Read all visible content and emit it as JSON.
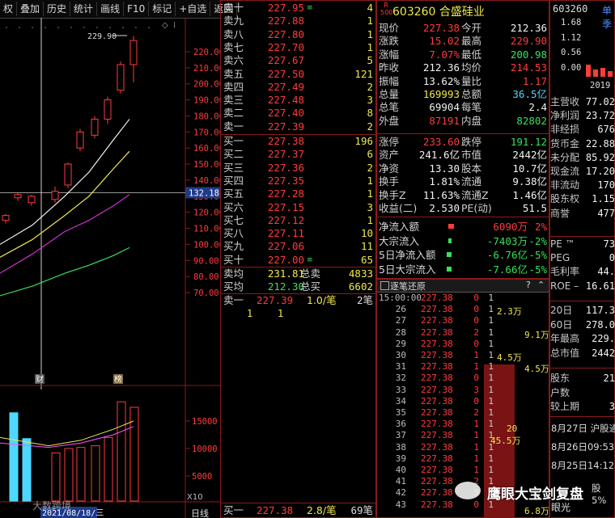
{
  "toolbar": {
    "items": [
      "权",
      "叠加",
      "历史",
      "统计",
      "画线",
      "F10",
      "标记",
      "+自选",
      "返回"
    ]
  },
  "kchart": {
    "high_label": "229.90",
    "price_ticks": [
      "220.00",
      "210.00",
      "200.00",
      "190.00",
      "180.00",
      "170.00",
      "160.00",
      "150.00",
      "140.00",
      "130.00",
      "120.00",
      "110.00",
      "100.00",
      "90.00",
      "80.00",
      "70.00"
    ],
    "current_tag": "132.18",
    "marker_cai": "财",
    "marker_bang": "榜",
    "vol_ticks": [
      "15000",
      "10000",
      "5000"
    ],
    "vol_unit": "X10",
    "date_label": "2021/08/18/三",
    "period_label": "日线",
    "watermark": "大数跨境"
  },
  "orderbook": {
    "sells": [
      {
        "label": "卖十",
        "price": "227.95",
        "vol": "4",
        "flag": "≡"
      },
      {
        "label": "卖九",
        "price": "227.88",
        "vol": "1"
      },
      {
        "label": "卖八",
        "price": "227.80",
        "vol": "1"
      },
      {
        "label": "卖七",
        "price": "227.70",
        "vol": "1"
      },
      {
        "label": "卖六",
        "price": "227.67",
        "vol": "5"
      },
      {
        "label": "卖五",
        "price": "227.50",
        "vol": "121"
      },
      {
        "label": "卖四",
        "price": "227.49",
        "vol": "2"
      },
      {
        "label": "卖三",
        "price": "227.48",
        "vol": "3"
      },
      {
        "label": "卖二",
        "price": "227.40",
        "vol": "8"
      },
      {
        "label": "卖一",
        "price": "227.39",
        "vol": "2"
      }
    ],
    "buys": [
      {
        "label": "买一",
        "price": "227.38",
        "vol": "196"
      },
      {
        "label": "买二",
        "price": "227.37",
        "vol": "6"
      },
      {
        "label": "买三",
        "price": "227.36",
        "vol": "2"
      },
      {
        "label": "买四",
        "price": "227.35",
        "vol": "1"
      },
      {
        "label": "买五",
        "price": "227.28",
        "vol": "1"
      },
      {
        "label": "买六",
        "price": "227.15",
        "vol": "3"
      },
      {
        "label": "买七",
        "price": "227.12",
        "vol": "1"
      },
      {
        "label": "买八",
        "price": "227.11",
        "vol": "10"
      },
      {
        "label": "买九",
        "price": "227.06",
        "vol": "11"
      },
      {
        "label": "买十",
        "price": "227.00",
        "vol": "65",
        "flag": "≡"
      }
    ],
    "avg_sell_label": "卖均",
    "avg_sell": "231.81",
    "total_sell_label": "总卖",
    "total_sell": "4833",
    "avg_buy_label": "买均",
    "avg_buy": "212.30",
    "total_buy_label": "总买",
    "total_buy": "6602",
    "queue_sell_label": "卖一",
    "queue_sell_price": "227.39",
    "queue_sell_ratio": "1.0/笔",
    "queue_sell_count": "2笔",
    "queue_sell_items": [
      "1",
      "1"
    ],
    "queue_buy_label": "买一",
    "queue_buy_price": "227.38",
    "queue_buy_ratio": "2.8/笔",
    "queue_buy_count": "69笔"
  },
  "stock": {
    "code": "603260",
    "name": "合盛硅业",
    "badge_top": "R",
    "badge_bottom": "500"
  },
  "quote": [
    {
      "l1": "现价",
      "v1": "227.38",
      "c1": "red",
      "l2": "今开",
      "v2": "212.36",
      "c2": "white"
    },
    {
      "l1": "涨跌",
      "v1": "15.02",
      "c1": "red",
      "l2": "最高",
      "v2": "229.90",
      "c2": "red"
    },
    {
      "l1": "涨幅",
      "v1": "7.07%",
      "c1": "red",
      "l2": "最低",
      "v2": "200.98",
      "c2": "green"
    },
    {
      "l1": "昨收",
      "v1": "212.36",
      "c1": "white",
      "l2": "均价",
      "v2": "214.53",
      "c2": "red"
    },
    {
      "l1": "振幅",
      "v1": "13.62%",
      "c1": "white",
      "l2": "量比",
      "v2": "1.17",
      "c2": "red"
    },
    {
      "l1": "总量",
      "v1": "169993",
      "c1": "yellow",
      "l2": "总额",
      "v2": "36.5亿",
      "c2": "cyan"
    },
    {
      "l1": "总笔",
      "v1": "69904",
      "c1": "white",
      "l2": "每笔",
      "v2": "2.4",
      "c2": "white"
    },
    {
      "l1": "外盘",
      "v1": "87191",
      "c1": "red",
      "l2": "内盘",
      "v2": "82802",
      "c2": "green"
    }
  ],
  "quote2": [
    {
      "l1": "涨停",
      "v1": "233.60",
      "c1": "red",
      "l2": "跌停",
      "v2": "191.12",
      "c2": "green"
    },
    {
      "l1": "资产",
      "v1": "241.6亿",
      "c1": "white",
      "l2": "市值",
      "v2": "2442亿",
      "c2": "white"
    },
    {
      "l1": "净资",
      "v1": "13.30",
      "c1": "white",
      "l2": "股本",
      "v2": "10.7亿",
      "c2": "white"
    },
    {
      "l1": "换手",
      "v1": "1.81%",
      "c1": "white",
      "l2": "流通",
      "v2": "9.38亿",
      "c2": "white"
    },
    {
      "l1": "换手Z",
      "v1": "11.63%",
      "c1": "white",
      "l2": "流通Z",
      "v2": "1.46亿",
      "c2": "white"
    },
    {
      "l1": "收益(二)",
      "v1": "2.530",
      "c1": "white",
      "l2": "PE(动)",
      "v2": "51.5",
      "c2": "white"
    }
  ],
  "flows": [
    {
      "label": "净流入额",
      "value": "6090万",
      "pct": "2%",
      "color": "red",
      "bar_pct": 0.6
    },
    {
      "label": "大宗流入",
      "value": "-7403万",
      "pct": "-2%",
      "color": "green",
      "bar_pct": 0.2
    },
    {
      "label": "5日净流入额",
      "value": "-6.76亿",
      "pct": "-5%",
      "color": "green",
      "bar_pct": 0.5
    },
    {
      "label": "5日大宗流入",
      "value": "-7.66亿",
      "pct": "-5%",
      "color": "green",
      "bar_pct": 0.5
    }
  ],
  "ticks_panel": {
    "title": "逐笔还原",
    "help": "?",
    "close": "⌃",
    "rows": [
      {
        "t": "15:00:00",
        "p": "227.38",
        "v": "0",
        "n": "1"
      },
      {
        "t": "26",
        "p": "227.38",
        "v": "0",
        "n": "1"
      },
      {
        "t": "27",
        "p": "227.38",
        "v": "0",
        "n": "1"
      },
      {
        "t": "28",
        "p": "227.38",
        "v": "2",
        "n": "1"
      },
      {
        "t": "29",
        "p": "227.38",
        "v": "0",
        "n": "1"
      },
      {
        "t": "30",
        "p": "227.38",
        "v": "1",
        "n": "1"
      },
      {
        "t": "31",
        "p": "227.38",
        "v": "1",
        "n": "1"
      },
      {
        "t": "32",
        "p": "227.38",
        "v": "0",
        "n": "1"
      },
      {
        "t": "33",
        "p": "227.38",
        "v": "3",
        "n": "1"
      },
      {
        "t": "34",
        "p": "227.38",
        "v": "0",
        "n": "1"
      },
      {
        "t": "35",
        "p": "227.38",
        "v": "2",
        "n": "1"
      },
      {
        "t": "36",
        "p": "227.38",
        "v": "1",
        "n": "1"
      },
      {
        "t": "37",
        "p": "227.38",
        "v": "1",
        "n": "1"
      },
      {
        "t": "38",
        "p": "227.38",
        "v": "1",
        "n": "1"
      },
      {
        "t": "39",
        "p": "227.38",
        "v": "1",
        "n": "1"
      },
      {
        "t": "40",
        "p": "227.38",
        "v": "1",
        "n": "1"
      },
      {
        "t": "41",
        "p": "227.38",
        "v": "2",
        "n": "1"
      },
      {
        "t": "42",
        "p": "227.38",
        "v": "5",
        "n": "1"
      },
      {
        "t": "43",
        "p": "227.38",
        "v": "0",
        "n": "1"
      }
    ],
    "side_labels": [
      {
        "text": "2.3万"
      },
      {
        "text": "9.1万"
      },
      {
        "text": "4.5万"
      },
      {
        "text": "4.5万"
      },
      {
        "text": "20"
      },
      {
        "text": "45.5万"
      },
      {
        "text": "6.8万"
      }
    ]
  },
  "right_panel": {
    "code": "603260",
    "tab": "单季",
    "mini_ticks": [
      "1.68",
      "1.12",
      "0.56",
      "0.00"
    ],
    "mini_year": "2019",
    "rows": [
      {
        "l": "主营收",
        "v": "77.02"
      },
      {
        "l": "净利润",
        "v": "23.72"
      },
      {
        "l": "非经损",
        "v": "676"
      },
      {
        "l": "货币金",
        "v": "22.88"
      },
      {
        "l": "未分配",
        "v": "85.92"
      },
      {
        "l": "现金流",
        "v": "17.20"
      },
      {
        "l": "非流动",
        "v": "170"
      },
      {
        "l": "股东权",
        "v": "1.15"
      },
      {
        "l": "商誉",
        "v": "477"
      }
    ],
    "rows2": [
      {
        "l": "PE ™",
        "v": "73"
      },
      {
        "l": "PEG",
        "v": "0"
      },
      {
        "l": "毛利率",
        "v": "44."
      },
      {
        "l": "ROE –",
        "v": "16.61"
      }
    ],
    "rows3": [
      {
        "l": "20日",
        "v": "117.3"
      },
      {
        "l": "60日",
        "v": "278.0"
      },
      {
        "l": "年最高",
        "v": "229."
      },
      {
        "l": "总市值",
        "v": "2442"
      }
    ],
    "rows4": [
      {
        "l": "股东",
        "v": "21"
      },
      {
        "l": "户数",
        "v": ""
      },
      {
        "l": "较上期",
        "v": "3"
      }
    ],
    "news": [
      "8月27日 沪股通",
      "8月26日09:53",
      "8月25日14:12"
    ],
    "bottom_l": "股5%",
    "bottom_l2": "眼光"
  },
  "watermark_wechat": "鹰眼大宝剑复盘"
}
